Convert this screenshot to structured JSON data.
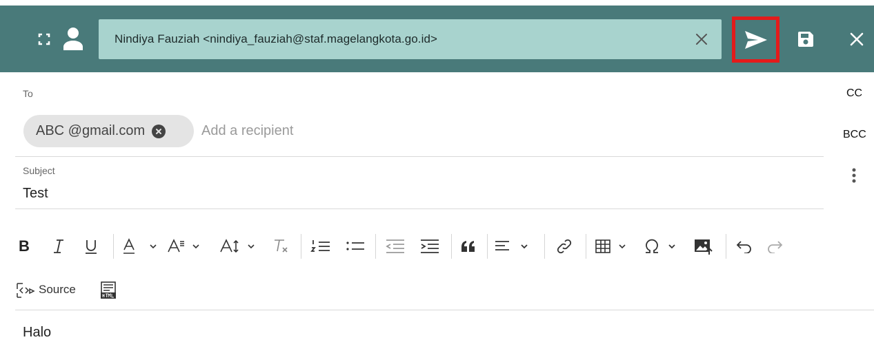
{
  "header": {
    "from_value": "Nindiya Fauziah <nindiya_fauziah@staf.magelangkota.go.id>",
    "icons": [
      "expand-icon",
      "person-icon",
      "clear-icon",
      "send-icon",
      "save-icon",
      "close-icon"
    ],
    "highlight_color": "#e31b1b",
    "bar_color": "#497a7a",
    "from_box_color": "#a8d3ce"
  },
  "fields": {
    "to_label": "To",
    "cc_label": "CC",
    "bcc_label": "BCC",
    "recipient_chip": "ABC @gmail.com",
    "recipient_placeholder": "Add a recipient",
    "subject_label": "Subject",
    "subject_value": "Test"
  },
  "toolbar": {
    "bold_label": "B",
    "source_label": "Source",
    "buttons": [
      "bold",
      "italic",
      "underline",
      "font-color",
      "font-family",
      "font-size",
      "clear-formatting",
      "numbered-list",
      "bulleted-list",
      "outdent",
      "indent",
      "blockquote",
      "align",
      "link",
      "table",
      "special-characters",
      "insert-image",
      "undo",
      "redo",
      "source",
      "html"
    ]
  },
  "body": {
    "text": "Halo"
  }
}
